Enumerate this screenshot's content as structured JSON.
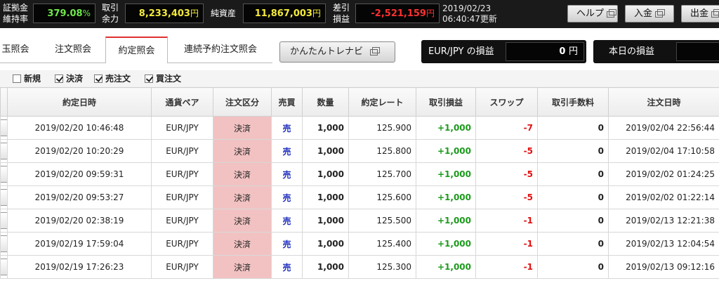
{
  "header": {
    "metrics": [
      {
        "label1": "証拠金",
        "label2": "維持率",
        "value": "379.08",
        "unit": "%",
        "color": "#6ee84a"
      },
      {
        "label1": "取引",
        "label2": "余力",
        "value": "8,233,403",
        "unit": "円",
        "color": "#f4ea3a"
      },
      {
        "label1": "純資産",
        "label2": "",
        "value": "11,867,003",
        "unit": "円",
        "color": "#f4ea3a"
      },
      {
        "label1": "差引",
        "label2": "損益",
        "value": "-2,521,159",
        "unit": "円",
        "color": "#ff3030"
      }
    ],
    "date": "2019/02/23",
    "time_updated": "06:40:47更新",
    "buttons": {
      "help": "ヘルプ",
      "deposit": "入金",
      "withdraw": "出金"
    }
  },
  "tabs": [
    {
      "label": "玉照会",
      "active": false
    },
    {
      "label": "注文照会",
      "active": false
    },
    {
      "label": "約定照会",
      "active": true
    },
    {
      "label": "連続予約注文照会",
      "active": false
    }
  ],
  "trainer_button": "かんたんトレナビ",
  "pl_pair": {
    "label": "EUR/JPY の損益",
    "value": "0",
    "unit": "円"
  },
  "pl_today": {
    "label": "本日の損益",
    "value": ""
  },
  "filters": [
    {
      "label": "新規",
      "checked": false
    },
    {
      "label": "決済",
      "checked": true
    },
    {
      "label": "売注文",
      "checked": true
    },
    {
      "label": "買注文",
      "checked": true
    }
  ],
  "table": {
    "columns": [
      "",
      "約定日時",
      "通貨ペア",
      "注文区分",
      "売買",
      "数量",
      "約定レート",
      "取引損益",
      "スワップ",
      "取引手数料",
      "注文日時"
    ],
    "rows": [
      {
        "exec_time": "2019/02/20 10:46:48",
        "pair": "EUR/JPY",
        "order_type": "決済",
        "side": "売",
        "qty": "1,000",
        "rate": "125.900",
        "pl": "+1,000",
        "swap": "-7",
        "fee": "0",
        "order_time": "2019/02/04 22:56:44"
      },
      {
        "exec_time": "2019/02/20 10:20:29",
        "pair": "EUR/JPY",
        "order_type": "決済",
        "side": "売",
        "qty": "1,000",
        "rate": "125.800",
        "pl": "+1,000",
        "swap": "-5",
        "fee": "0",
        "order_time": "2019/02/04 17:10:58"
      },
      {
        "exec_time": "2019/02/20 09:59:31",
        "pair": "EUR/JPY",
        "order_type": "決済",
        "side": "売",
        "qty": "1,000",
        "rate": "125.700",
        "pl": "+1,000",
        "swap": "-5",
        "fee": "0",
        "order_time": "2019/02/02 01:24:25"
      },
      {
        "exec_time": "2019/02/20 09:53:27",
        "pair": "EUR/JPY",
        "order_type": "決済",
        "side": "売",
        "qty": "1,000",
        "rate": "125.600",
        "pl": "+1,000",
        "swap": "-5",
        "fee": "0",
        "order_time": "2019/02/02 01:22:14"
      },
      {
        "exec_time": "2019/02/20 02:38:19",
        "pair": "EUR/JPY",
        "order_type": "決済",
        "side": "売",
        "qty": "1,000",
        "rate": "125.500",
        "pl": "+1,000",
        "swap": "-1",
        "fee": "0",
        "order_time": "2019/02/13 12:21:38"
      },
      {
        "exec_time": "2019/02/19 17:59:04",
        "pair": "EUR/JPY",
        "order_type": "決済",
        "side": "売",
        "qty": "1,000",
        "rate": "125.400",
        "pl": "+1,000",
        "swap": "-1",
        "fee": "0",
        "order_time": "2019/02/13 12:04:54"
      },
      {
        "exec_time": "2019/02/19 17:26:23",
        "pair": "EUR/JPY",
        "order_type": "決済",
        "side": "売",
        "qty": "1,000",
        "rate": "125.300",
        "pl": "+1,000",
        "swap": "-1",
        "fee": "0",
        "order_time": "2019/02/13 09:12:16"
      }
    ]
  }
}
